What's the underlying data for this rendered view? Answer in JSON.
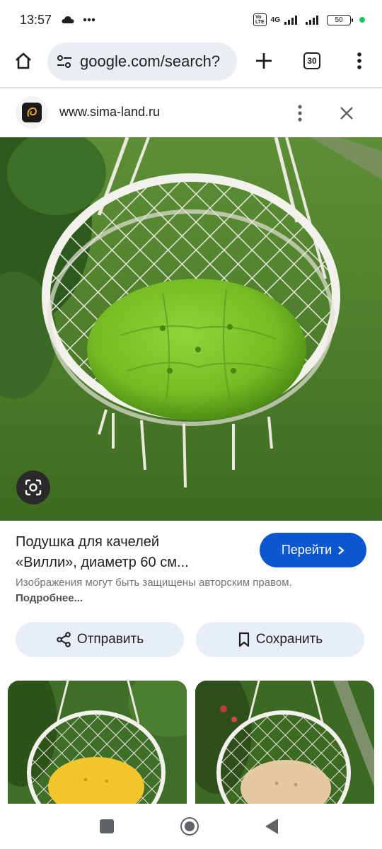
{
  "status_bar": {
    "time": "13:57",
    "network": "4G",
    "battery": "50"
  },
  "browser": {
    "url": "google.com/search?",
    "tab_count": "30"
  },
  "source": {
    "site": "www.sima-land.ru"
  },
  "result": {
    "title_line1": "Подушка для качелей",
    "title_line2": "«Вилли», диаметр 60 см...",
    "visit_label": "Перейти",
    "copyright_text": "Изображения могут быть защищены авторским правом.",
    "more_link": "Подробнее..."
  },
  "actions": {
    "share_label": "Отправить",
    "save_label": "Сохранить"
  },
  "colors": {
    "accent": "#0b57d0",
    "pill_bg": "#e8eef7",
    "url_bg": "#eaeef3",
    "cushion_main": "#7cc22a",
    "cushion_yellow": "#f2c62a",
    "cushion_beige": "#e6c9a3"
  },
  "icons": {
    "home": "home-icon",
    "site_settings": "tune-icon",
    "new_tab": "plus-icon",
    "tabs": "tab-switcher-icon",
    "menu": "more-vert-icon",
    "close": "close-icon",
    "lens": "google-lens-icon",
    "share": "share-icon",
    "save": "bookmark-icon"
  }
}
